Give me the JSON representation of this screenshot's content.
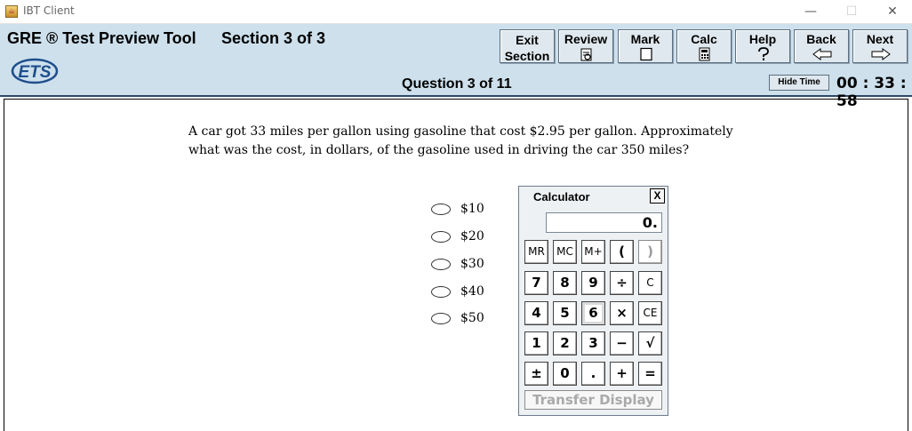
{
  "window": {
    "title": "IBT Client",
    "controls": {
      "minimize": "—",
      "maximize": "☐",
      "close": "✕"
    }
  },
  "header": {
    "test_title": "GRE ® Test Preview Tool",
    "section_title": "Section 3 of 3",
    "logo_text": "ETS",
    "question_counter": "Question 3 of 11",
    "hide_time_label": "Hide Time",
    "timer": "00 : 33 : 58",
    "buttons": [
      {
        "id": "exit",
        "label_line1": "Exit",
        "label_line2": "Section"
      },
      {
        "id": "review",
        "label": "Review",
        "icon": "review-icon"
      },
      {
        "id": "mark",
        "label": "Mark",
        "icon": "checkbox-icon"
      },
      {
        "id": "calc",
        "label": "Calc",
        "icon": "calculator-icon"
      },
      {
        "id": "help",
        "label": "Help",
        "icon": "question-mark-icon"
      },
      {
        "id": "back",
        "label": "Back",
        "icon": "arrow-left-icon"
      },
      {
        "id": "next",
        "label": "Next",
        "icon": "arrow-right-icon"
      }
    ]
  },
  "question": {
    "text": "A car got 33 miles per gallon using gasoline that cost $2.95 per gallon.  Approximately what was the cost, in dollars, of the gasoline used in driving the car 350 miles?",
    "choices": [
      "$10",
      "$20",
      "$30",
      "$40",
      "$50"
    ]
  },
  "calculator": {
    "title": "Calculator",
    "close_label": "X",
    "display": "0.",
    "rows": [
      [
        "MR",
        "MC",
        "M+",
        "(",
        ")"
      ],
      [
        "7",
        "8",
        "9",
        "÷",
        "C"
      ],
      [
        "4",
        "5",
        "6",
        "×",
        "CE"
      ],
      [
        "1",
        "2",
        "3",
        "−",
        "√"
      ],
      [
        "±",
        "0",
        ".",
        "+",
        "="
      ]
    ],
    "transfer_label": "Transfer Display"
  },
  "colors": {
    "header_bg": "#cde0ec",
    "header_border": "#2c4a68",
    "button_bg": "#dfe8ee",
    "ets_blue": "#1f4e8c"
  }
}
